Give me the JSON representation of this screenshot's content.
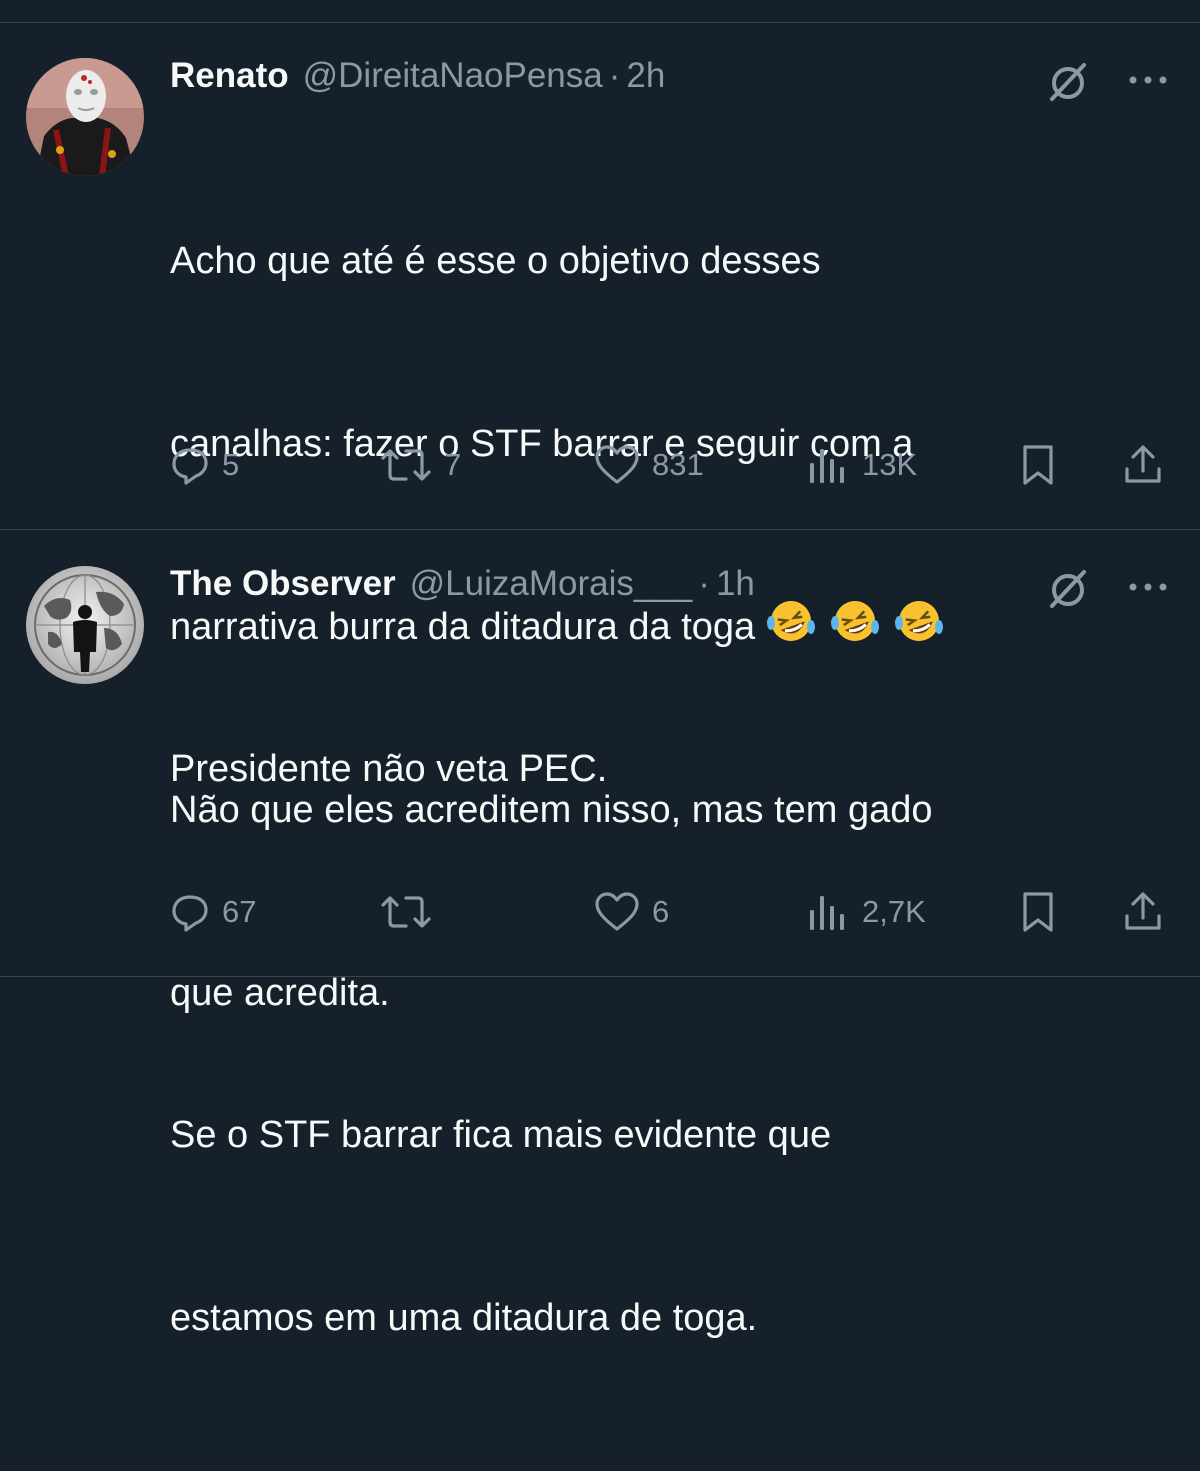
{
  "tweets": [
    {
      "name": "Renato",
      "handle": "@DireitaNaoPensa",
      "separator": "·",
      "time": "2h",
      "text_lines": [
        "Acho que até é esse o objetivo desses",
        "canalhas: fazer o STF barrar e seguir com a",
        "narrativa burra da ditadura da toga",
        "Não que eles acreditem nisso, mas tem gado",
        "que acredita."
      ],
      "emojis": [
        "rolling-on-floor-laughing",
        "rolling-on-floor-laughing",
        "rolling-on-floor-laughing"
      ],
      "replies": "5",
      "reposts": "7",
      "likes": "831",
      "views": "13K"
    },
    {
      "name": "The Observer",
      "handle": "@LuizaMorais___",
      "separator": "·",
      "time": "1h",
      "text_lines": [
        "Presidente não veta PEC.",
        "",
        "Se o STF barrar fica mais evidente que",
        "estamos em uma ditadura de toga."
      ],
      "replies": "67",
      "reposts": "",
      "likes": "6",
      "views": "2,7K"
    }
  ],
  "colors": {
    "background": "#15202b",
    "text": "#f7f9f9",
    "secondary": "#8b98a5",
    "divider": "#38444d"
  },
  "icons": [
    "grok-icon",
    "more-icon",
    "reply-icon",
    "repost-icon",
    "like-icon",
    "views-icon",
    "bookmark-icon",
    "share-icon"
  ]
}
